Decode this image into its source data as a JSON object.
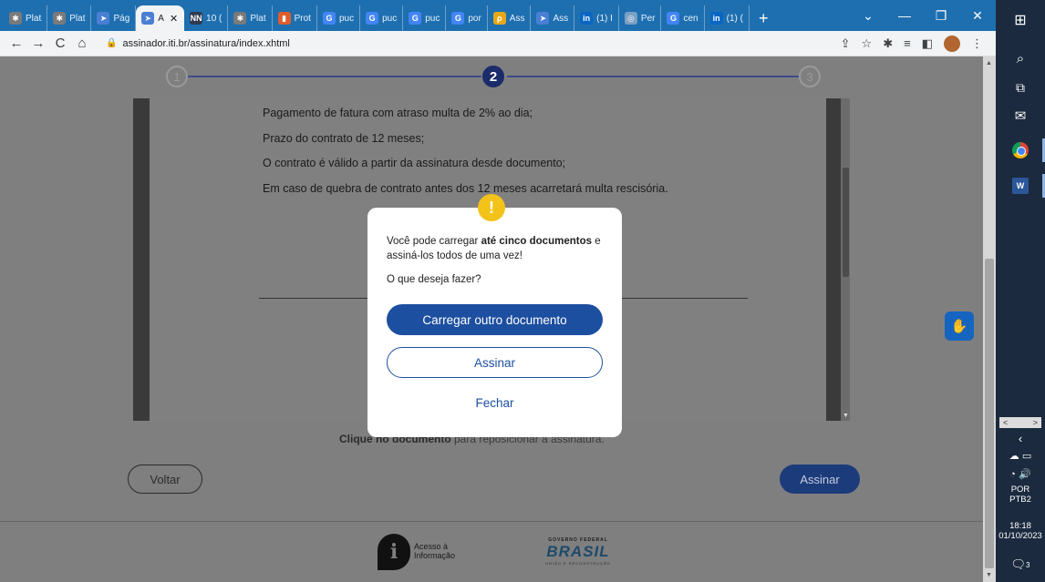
{
  "browser": {
    "tabs": [
      {
        "label": "Plat",
        "fav": "✱",
        "color": "#7a7a7a"
      },
      {
        "label": "Plat",
        "fav": "✱",
        "color": "#7a7a7a"
      },
      {
        "label": "Pág",
        "fav": "➤",
        "color": "#4a7fd4"
      },
      {
        "label": "A",
        "fav": "➤",
        "color": "#4a7fd4",
        "active": true
      },
      {
        "label": "10 (",
        "fav": "NN",
        "color": "#2d3a4f"
      },
      {
        "label": "Plat",
        "fav": "✱",
        "color": "#7a7a7a"
      },
      {
        "label": "Prot",
        "fav": "▮",
        "color": "#e25c2a"
      },
      {
        "label": "puc",
        "fav": "G",
        "color": "#4285f4"
      },
      {
        "label": "puc",
        "fav": "G",
        "color": "#4285f4"
      },
      {
        "label": "puc",
        "fav": "G",
        "color": "#4285f4"
      },
      {
        "label": "por",
        "fav": "G",
        "color": "#4285f4"
      },
      {
        "label": "Ass",
        "fav": "ρ",
        "color": "#e6a817"
      },
      {
        "label": "Ass",
        "fav": "➤",
        "color": "#4a7fd4"
      },
      {
        "label": "(1) I",
        "fav": "in",
        "color": "#0a66c2"
      },
      {
        "label": "Per",
        "fav": "◎",
        "color": "#7aa0c4"
      },
      {
        "label": "cen",
        "fav": "G",
        "color": "#4285f4"
      },
      {
        "label": "(1) (",
        "fav": "in",
        "color": "#0a66c2"
      }
    ],
    "new_tab": "+",
    "url": "assinador.iti.br/assinatura/index.xhtml",
    "window_controls": {
      "dropdown": "⌄",
      "minimize": "—",
      "maximize": "❐",
      "close": "✕"
    }
  },
  "stepper": {
    "steps": [
      "1",
      "2",
      "3"
    ],
    "active_step": 2
  },
  "document": {
    "lines": [
      "Pagamento de fatura com atraso multa de 2% ao dia;",
      "Prazo do contrato de 12 meses;",
      "O contrato é válido a partir da assinatura desde documento;",
      "Em caso de quebra de contrato antes dos 12 meses acarretará multa rescisória."
    ]
  },
  "hint": {
    "bold": "Clique no documento",
    "rest": " para reposicionar a assinatura."
  },
  "actions": {
    "back_label": "Voltar",
    "sign_label": "Assinar"
  },
  "modal": {
    "message_prefix": "Você pode carregar ",
    "message_bold": "até cinco documentos",
    "message_suffix": " e assiná-los todos de uma vez!",
    "question": "O que deseja fazer?",
    "primary_label": "Carregar outro documento",
    "secondary_label": "Assinar",
    "close_label": "Fechar",
    "icon": "!"
  },
  "footer": {
    "acesso_line1": "Acesso à",
    "acesso_line2": "Informação",
    "gov_top": "GOVERNO FEDERAL",
    "gov_brand": "BRASIL",
    "gov_sub": "UNIÃO E RECONSTRUÇÃO"
  },
  "taskbar": {
    "language": "POR",
    "layout": "PTB2",
    "time": "18:18",
    "date": "01/10/2023",
    "notifications": "3"
  }
}
